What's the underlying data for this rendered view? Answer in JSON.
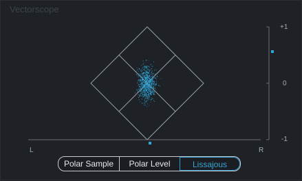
{
  "window": {
    "title": "Vectorscope"
  },
  "scale": {
    "top": "+1",
    "middle": "0",
    "bottom": "-1"
  },
  "channels": {
    "left": "L",
    "right": "R"
  },
  "modes": {
    "items": [
      "Polar Sample",
      "Polar Level",
      "Lissajous"
    ],
    "selected": "Lissajous"
  },
  "colors": {
    "background": "#1e2125",
    "accent": "#2fa6d8",
    "grid": "#9aa0a7"
  }
}
